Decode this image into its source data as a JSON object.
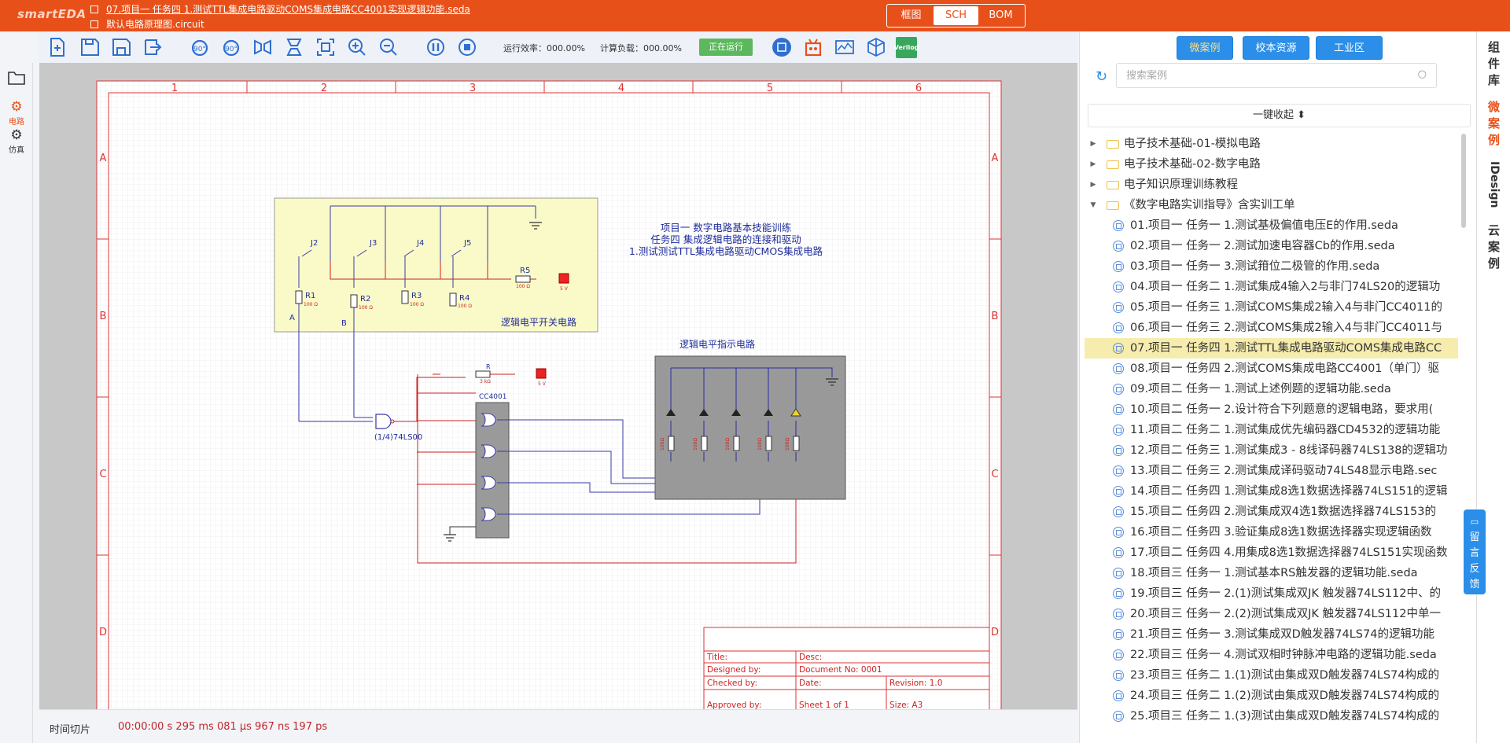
{
  "app": {
    "logo": "smartEDA"
  },
  "files": {
    "active": "07.项目一 任务四 1.测试TTL集成电路驱动COMS集成电路CC4001实现逻辑功能.seda",
    "circuit": "默认电路原理图.circuit"
  },
  "view_tabs": [
    {
      "label": "框图"
    },
    {
      "label": "SCH"
    },
    {
      "label": "BOM"
    }
  ],
  "toolbar": {
    "efficiency_label": "运行效率：000.00%",
    "load_label": "计算负载：000.00%",
    "running_label": "正在运行",
    "verilog_label": "Verilog"
  },
  "left_sidebar": {
    "circuit_label": "电路",
    "sim_label": "仿真"
  },
  "status": {
    "label": "时间切片",
    "time": "00:00:00 s 295 ms 081 μs 967 ns 197 ps"
  },
  "right_panel": {
    "tabs": [
      "微案例",
      "校本资源",
      "工业区"
    ],
    "search_placeholder": "搜索案例",
    "collapse_label": "一键收起 ⬍",
    "tree": [
      {
        "kind": "folder",
        "label": "电子技术基础-01-模拟电路"
      },
      {
        "kind": "folder",
        "label": "电子技术基础-02-数字电路"
      },
      {
        "kind": "folder",
        "label": "电子知识原理训练教程"
      },
      {
        "kind": "folder-open",
        "label": "《数字电路实训指导》含实训工单"
      },
      {
        "kind": "case",
        "label": "01.项目一 任务一 1.测试基极偏值电压E的作用.seda"
      },
      {
        "kind": "case",
        "label": "02.项目一 任务一 2.测试加速电容器Cb的作用.seda"
      },
      {
        "kind": "case",
        "label": "03.项目一 任务一 3.测试箝位二极管的作用.seda"
      },
      {
        "kind": "case",
        "label": "04.项目一 任务二 1.测试集成4输入2与非门74LS20的逻辑功"
      },
      {
        "kind": "case",
        "label": "05.项目一 任务三 1.测试COMS集成2输入4与非门CC4011的"
      },
      {
        "kind": "case",
        "label": "06.项目一 任务三 2.测试COMS集成2输入4与非门CC4011与"
      },
      {
        "kind": "case",
        "label": "07.项目一 任务四 1.测试TTL集成电路驱动COMS集成电路CC",
        "selected": true
      },
      {
        "kind": "case",
        "label": "08.项目一 任务四 2.测试COMS集成电路CC4001（单门）驱"
      },
      {
        "kind": "case",
        "label": "09.项目二 任务一 1.测试上述例题的逻辑功能.seda"
      },
      {
        "kind": "case",
        "label": "10.项目二 任务一 2.设计符合下列题意的逻辑电路，要求用("
      },
      {
        "kind": "case",
        "label": "11.项目二 任务二 1.测试集成优先编码器CD4532的逻辑功能"
      },
      {
        "kind": "case",
        "label": "12.项目二 任务三 1.测试集成3 - 8线译码器74LS138的逻辑功"
      },
      {
        "kind": "case",
        "label": "13.项目二 任务三 2.测试集成译码驱动74LS48显示电路.sec"
      },
      {
        "kind": "case",
        "label": "14.项目二 任务四 1.测试集成8选1数据选择器74LS151的逻辑"
      },
      {
        "kind": "case",
        "label": "15.项目二 任务四 2.测试集成双4选1数据选择器74LS153的"
      },
      {
        "kind": "case",
        "label": "16.项目二 任务四 3.验证集成8选1数据选择器实现逻辑函数"
      },
      {
        "kind": "case",
        "label": "17.项目二 任务四 4.用集成8选1数据选择器74LS151实现函数"
      },
      {
        "kind": "case",
        "label": "18.项目三 任务一 1.测试基本RS触发器的逻辑功能.seda"
      },
      {
        "kind": "case",
        "label": "19.项目三 任务一 2.(1)测试集成双JK 触发器74LS112中、的"
      },
      {
        "kind": "case",
        "label": "20.项目三 任务一 2.(2)测试集成双JK 触发器74LS112中单一"
      },
      {
        "kind": "case",
        "label": "21.项目三 任务一 3.测试集成双D触发器74LS74的逻辑功能"
      },
      {
        "kind": "case",
        "label": "22.项目三 任务一 4.测试双相时钟脉冲电路的逻辑功能.seda"
      },
      {
        "kind": "case",
        "label": "23.项目三 任务二 1.(1)测试由集成双D触发器74LS74构成的"
      },
      {
        "kind": "case",
        "label": "24.项目三 任务二 1.(2)测试由集成双D触发器74LS74构成的"
      },
      {
        "kind": "case",
        "label": "25.项目三 任务二 1.(3)测试由集成双D触发器74LS74构成的"
      }
    ]
  },
  "vertical_tabs": [
    "组件库",
    "微案例",
    "IDesign",
    "云案例"
  ],
  "feedback": "留言反馈",
  "schematic": {
    "col_labels": [
      "1",
      "2",
      "3",
      "4",
      "5",
      "6"
    ],
    "row_labels": [
      "A",
      "B",
      "C",
      "D"
    ],
    "note_line1": "项目一   数字电路基本技能训练",
    "note_line2": "任务四  集成逻辑电路的连接和驱动",
    "note_line3": "1.测试测试TTL集成电路驱动CMOS集成电路",
    "switch_box_label": "逻辑电平开关电路",
    "indicator_label": "逻辑电平指示电路",
    "switches": [
      "J2",
      "J3",
      "J4",
      "J5"
    ],
    "resistors": [
      "R1",
      "R2",
      "R3",
      "R4"
    ],
    "res_value": "100 Ω",
    "r5": "R5",
    "r": "R",
    "r_value": "3 kΩ",
    "vcc": "5 V",
    "node_a": "A",
    "node_b": "B",
    "chip": "CC4001",
    "gate": "(1/4)74LS00",
    "led_res": "100Ω",
    "title_block": {
      "title": "Title:",
      "desc": "Desc:",
      "designed": "Designed by:",
      "docno": "Document No: 0001",
      "checked": "Checked by:",
      "date": "Date:",
      "revision": "Revision: 1.0",
      "approved": "Approved by:",
      "sheet": "Sheet 1 of 1",
      "size": "Size: A3"
    }
  }
}
